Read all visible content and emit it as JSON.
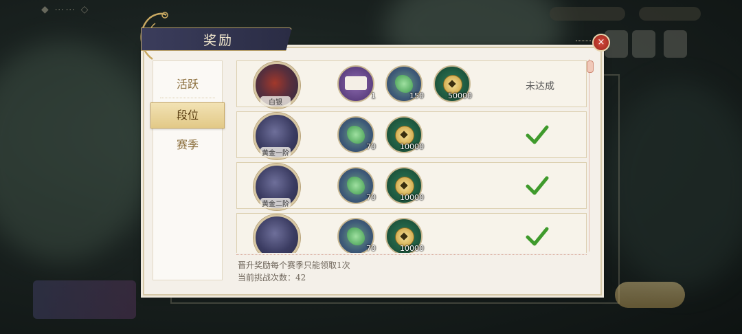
{
  "window": {
    "title": "奖励",
    "close_label": "×"
  },
  "tabs": [
    {
      "label": "活跃",
      "selected": false
    },
    {
      "label": "段位",
      "selected": true
    },
    {
      "label": "赛季",
      "selected": false
    }
  ],
  "rows": [
    {
      "rank": "白银",
      "rewards": [
        {
          "icon": "scroll-icon",
          "qty": "1"
        },
        {
          "icon": "jade-icon",
          "qty": "150"
        },
        {
          "icon": "coin-icon",
          "qty": "50000"
        }
      ],
      "status": "未达成",
      "achieved": false
    },
    {
      "rank": "黄金一阶",
      "rewards": [
        {
          "icon": "jade-icon",
          "qty": "70"
        },
        {
          "icon": "coin-icon",
          "qty": "10000"
        }
      ],
      "status": "",
      "achieved": true
    },
    {
      "rank": "黄金二阶",
      "rewards": [
        {
          "icon": "jade-icon",
          "qty": "70"
        },
        {
          "icon": "coin-icon",
          "qty": "10000"
        }
      ],
      "status": "",
      "achieved": true
    },
    {
      "rank": "",
      "rewards": [
        {
          "icon": "jade-icon",
          "qty": "70"
        },
        {
          "icon": "coin-icon",
          "qty": "10000"
        }
      ],
      "status": "",
      "achieved": true
    }
  ],
  "notes": {
    "line1": "晋升奖励每个赛季只能领取1次",
    "line2": "当前挑战次数：42"
  },
  "colors": {
    "check": "#3f9a2c",
    "accent": "#c9a962",
    "close": "#c03a2e"
  }
}
